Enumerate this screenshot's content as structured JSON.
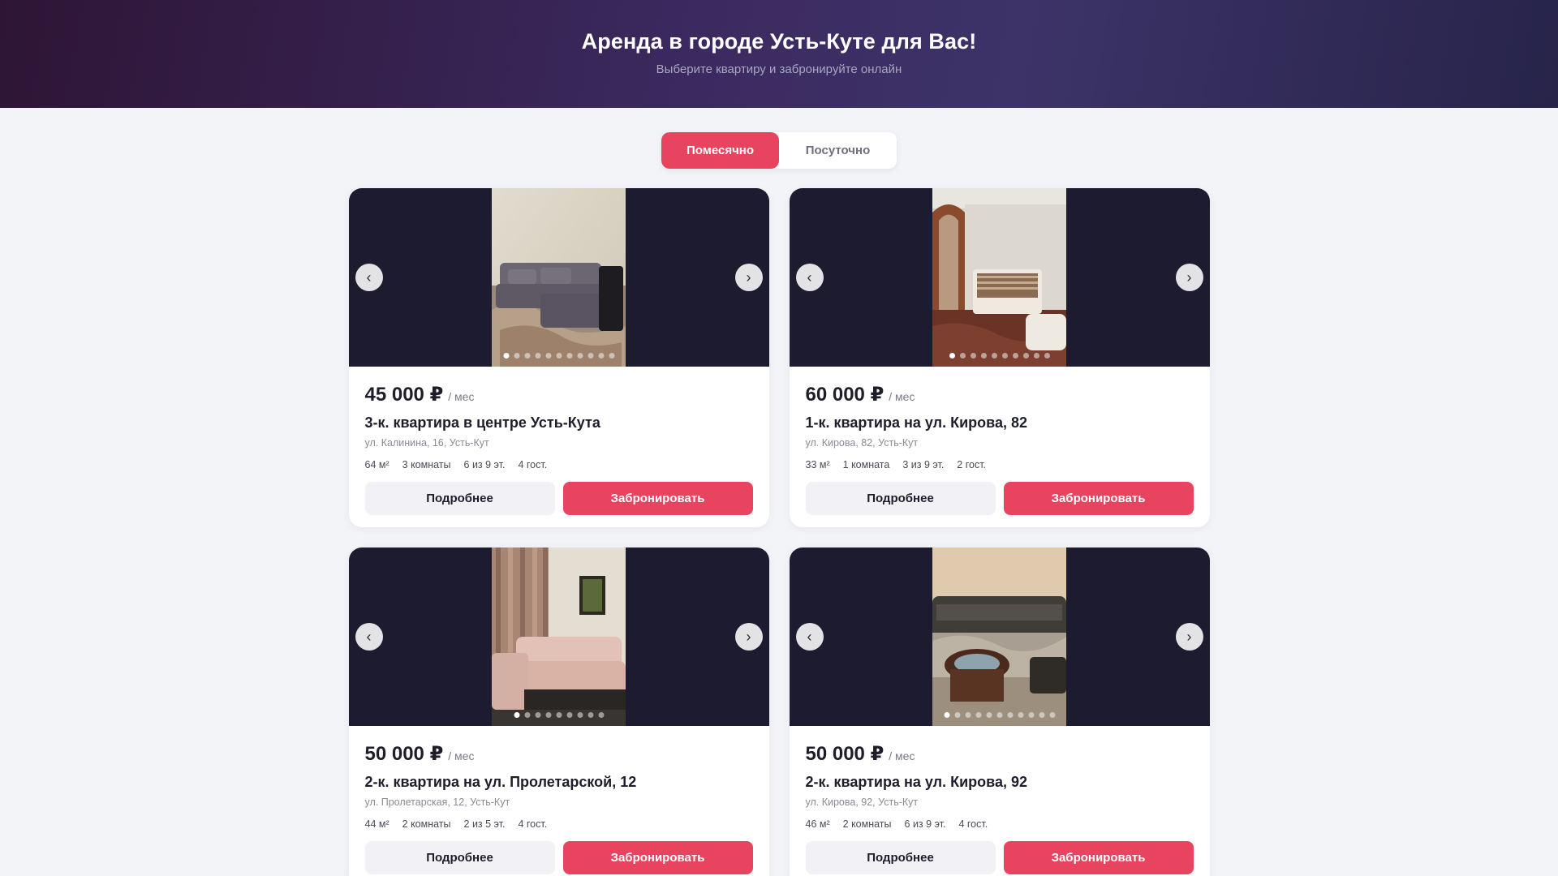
{
  "header": {
    "title": "Аренда в городе Усть-Куте для Вас!",
    "subtitle": "Выберите квартиру и забронируйте онлайн"
  },
  "tabs": [
    {
      "label": "Помесячно",
      "active": true
    },
    {
      "label": "Посуточно",
      "active": false
    }
  ],
  "colors": {
    "accent": "#e8445f",
    "gallery_bg": "#1c1b2f",
    "page_bg": "#f3f4f8"
  },
  "icons": {
    "prev": "chevron-left-icon",
    "next": "chevron-right-icon"
  },
  "nav": {
    "prev": "‹",
    "next": "›"
  },
  "listings": [
    {
      "price": "45 000 ₽",
      "period": "/ мес",
      "title": "3-к. квартира в центре Усть-Кута",
      "address": "ул. Калинина, 16, Усть-Кут",
      "area": "64 м²",
      "rooms": "3 комнаты",
      "floor": "6 из 9 эт.",
      "guests": "4 гост.",
      "photo_count": 11,
      "current_photo": 1,
      "details_label": "Подробнее",
      "book_label": "Забронировать"
    },
    {
      "price": "60 000 ₽",
      "period": "/ мес",
      "title": "1-к. квартира на ул. Кирова, 82",
      "address": "ул. Кирова, 82, Усть-Кут",
      "area": "33 м²",
      "rooms": "1 комната",
      "floor": "3 из 9 эт.",
      "guests": "2 гост.",
      "photo_count": 10,
      "current_photo": 1,
      "details_label": "Подробнее",
      "book_label": "Забронировать"
    },
    {
      "price": "50 000 ₽",
      "period": "/ мес",
      "title": "2-к. квартира на ул. Пролетарской, 12",
      "address": "ул. Пролетарская, 12, Усть-Кут",
      "area": "44 м²",
      "rooms": "2 комнаты",
      "floor": "2 из 5 эт.",
      "guests": "4 гост.",
      "photo_count": 9,
      "current_photo": 1,
      "details_label": "Подробнее",
      "book_label": "Забронировать"
    },
    {
      "price": "50 000 ₽",
      "period": "/ мес",
      "title": "2-к. квартира на ул. Кирова, 92",
      "address": "ул. Кирова, 92, Усть-Кут",
      "area": "46 м²",
      "rooms": "2 комнаты",
      "floor": "6 из 9 эт.",
      "guests": "4 гост.",
      "photo_count": 11,
      "current_photo": 1,
      "details_label": "Подробнее",
      "book_label": "Забронировать"
    }
  ]
}
